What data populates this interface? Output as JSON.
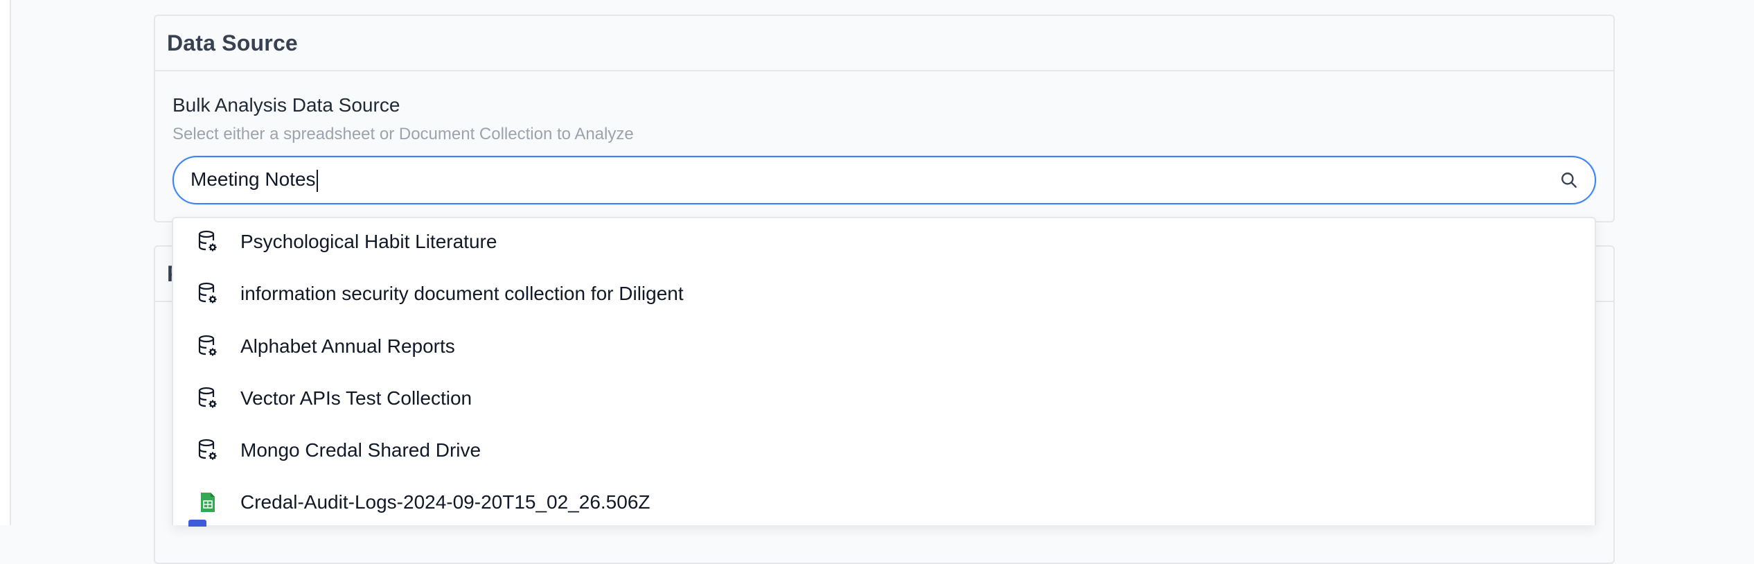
{
  "data_source_card": {
    "title": "Data Source",
    "field_label": "Bulk Analysis Data Source",
    "field_help": "Select either a spreadsheet or Document Collection to Analyze",
    "search": {
      "value": "Meeting Notes",
      "icon": "search-icon"
    }
  },
  "second_card": {
    "title": "P"
  },
  "dropdown": {
    "options": [
      {
        "label": "Psychological Habit Literature",
        "icon": "database-gear-icon"
      },
      {
        "label": "information security document collection for Diligent",
        "icon": "database-gear-icon"
      },
      {
        "label": "Alphabet Annual Reports",
        "icon": "database-gear-icon"
      },
      {
        "label": "Vector APIs Test Collection",
        "icon": "database-gear-icon"
      },
      {
        "label": "Mongo Credal Shared Drive",
        "icon": "database-gear-icon"
      },
      {
        "label": "Credal-Audit-Logs-2024-09-20T15_02_26.506Z",
        "icon": "spreadsheet-icon"
      }
    ]
  },
  "colors": {
    "accent": "#3b82f6",
    "sheet_green": "#34a853",
    "border": "#e5e7eb"
  }
}
